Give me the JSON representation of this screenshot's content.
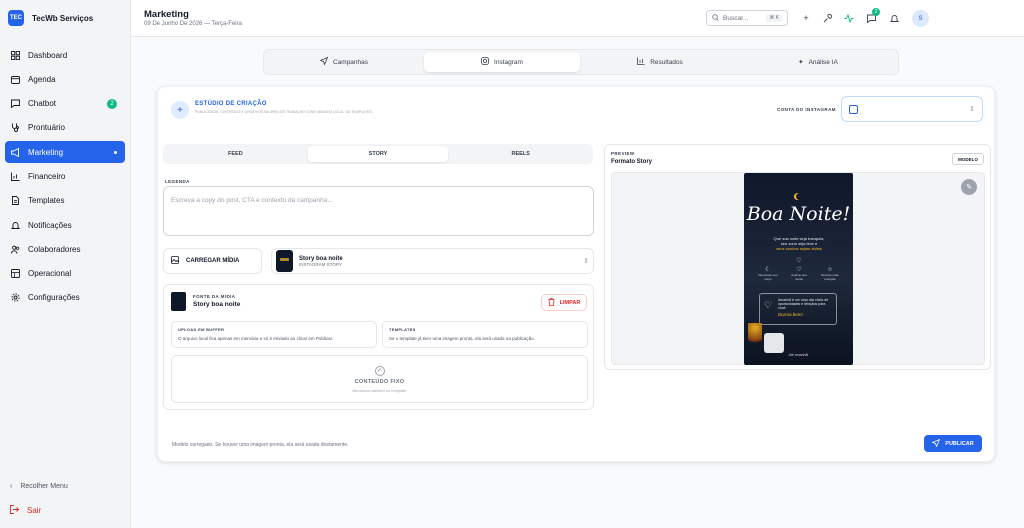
{
  "app": {
    "brand": "TecWb Serviços",
    "logo_text": "TEC"
  },
  "sidebar": {
    "items": [
      {
        "label": "Dashboard",
        "icon": "grid-icon"
      },
      {
        "label": "Agenda",
        "icon": "calendar-icon"
      },
      {
        "label": "Chatbot",
        "icon": "chat-icon",
        "badge": "2"
      },
      {
        "label": "Prontuário",
        "icon": "stethoscope-icon"
      },
      {
        "label": "Marketing",
        "icon": "megaphone-icon",
        "active": true
      },
      {
        "label": "Financeiro",
        "icon": "chart-icon"
      },
      {
        "label": "Templates",
        "icon": "file-icon"
      },
      {
        "label": "Notificações",
        "icon": "bell-icon"
      },
      {
        "label": "Colaboradores",
        "icon": "users-icon"
      },
      {
        "label": "Operacional",
        "icon": "table-icon"
      },
      {
        "label": "Configurações",
        "icon": "gear-icon"
      }
    ],
    "collapse_label": "Recolher Menu",
    "logout_label": "Sair"
  },
  "header": {
    "title": "Marketing",
    "date": "09 De Junho De 2026 — Terça-Feira",
    "search_placeholder": "Buscar...",
    "search_shortcut": "⌘ K",
    "messages_badge": "2",
    "avatar_initial": "S"
  },
  "main_tabs": [
    {
      "label": "Campanhas",
      "icon": "send-icon"
    },
    {
      "label": "Instagram",
      "icon": "instagram-icon",
      "active": true
    },
    {
      "label": "Resultados",
      "icon": "bar-chart-icon"
    },
    {
      "label": "Análise IA",
      "icon": "sparkles-icon"
    }
  ],
  "studio": {
    "title": "ESTÚDIO DE CRIAÇÃO",
    "subtitle": "PUBLICIDADE, CONTEÚDO E CRIATIVOS NA ÁREA DE TRABALHO COMO IMAGEM LOCAL OU TEMPLATES.",
    "account_label": "CONTA DO INSTAGRAM"
  },
  "format_tabs": [
    "FEED",
    "STORY",
    "REELS"
  ],
  "active_format": "STORY",
  "caption": {
    "label": "LEGENDA",
    "placeholder": "Escreva a copy do post, CTA e contexto da campanha..."
  },
  "upload_label": "CARREGAR MÍDIA",
  "template": {
    "title": "Story boa noite",
    "subtitle": "INSTAGRAM STORY"
  },
  "source": {
    "label": "FONTE DA MÍDIA",
    "name": "Story boa noite",
    "clear_label": "LIMPAR",
    "buffer_title": "UPLOAD EM BUFFER",
    "buffer_text": "O arquivo local fica apenas em memória e só é enviado ao clicar em Publicar.",
    "templates_title": "TEMPLATES",
    "templates_text": "Se o template já tiver uma imagem pronta, ela será usada na publicação.",
    "fixed_title": "CONTEÚDO FIXO",
    "fixed_sub": "Nenhuma variável no template"
  },
  "preview": {
    "label": "PREVIEW",
    "title": "Formato Story",
    "model_label": "MODELO",
    "story": {
      "headline": "Boa Noite!",
      "line1": "Que sua noite seja tranquila,",
      "line2": "seu sono seja leve e",
      "line3": "seus sonhos sejam lindos",
      "items": [
        "Descanse seu corpo",
        "Acalme sua mente",
        "Renove suas energias"
      ],
      "box_text": "Amanhã é um novo dia cheio de oportunidades e bênçãos para você.",
      "box_em": "Durma bem!",
      "footer": "Até amanhã!"
    }
  },
  "footnote": "Modelo carregado. Se houver uma imagem pronta, ela será usada diretamente.",
  "publish_label": "PUBLICAR",
  "colors": {
    "accent": "#2563eb",
    "success": "#10b981",
    "danger": "#dc2626"
  }
}
